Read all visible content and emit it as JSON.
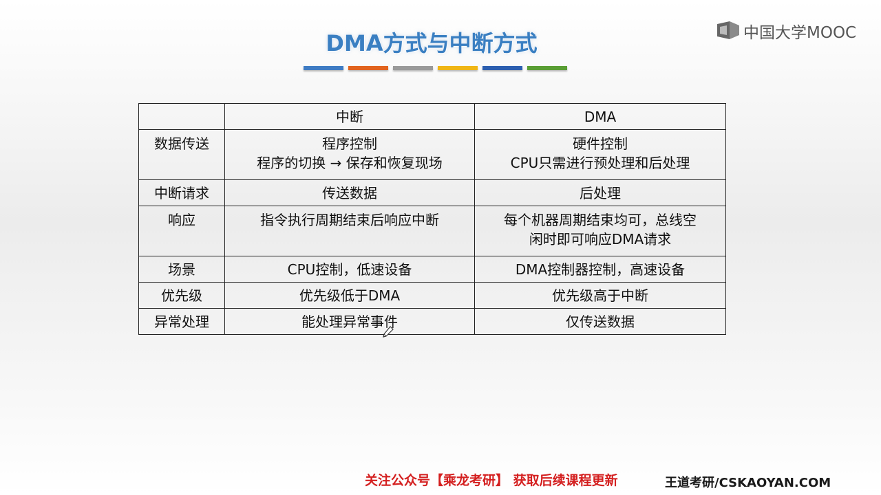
{
  "logo": {
    "text": "中国大学MOOC",
    "icon": "mooc-logo-icon"
  },
  "slide": {
    "title": "DMA方式与中断方式",
    "accent_colors": [
      "#3f7cc4",
      "#e2641f",
      "#9a9a9a",
      "#f0b616",
      "#2d5fb0",
      "#5a9e35"
    ]
  },
  "table": {
    "headers": [
      "",
      "中断",
      "DMA"
    ],
    "rows": [
      {
        "label": "数据传送",
        "interrupt": [
          "程序控制",
          "程序的切换 → 保存和恢复现场"
        ],
        "dma": [
          "硬件控制",
          "CPU只需进行预处理和后处理"
        ]
      },
      {
        "label": "中断请求",
        "interrupt": [
          "传送数据"
        ],
        "dma": [
          "后处理"
        ]
      },
      {
        "label": "响应",
        "interrupt": [
          "指令执行周期结束后响应中断"
        ],
        "dma": [
          "每个机器周期结束均可，总线空",
          "闲时即可响应DMA请求"
        ]
      },
      {
        "label": "场景",
        "interrupt": [
          "CPU控制，低速设备"
        ],
        "dma": [
          "DMA控制器控制，高速设备"
        ]
      },
      {
        "label": "优先级",
        "interrupt": [
          "优先级低于DMA"
        ],
        "dma": [
          "优先级高于中断"
        ]
      },
      {
        "label": "异常处理",
        "interrupt": [
          "能处理异常事件"
        ],
        "dma": [
          "仅传送数据"
        ]
      }
    ]
  },
  "footer": {
    "promo": "关注公众号【乘龙考研】 获取后续课程更新",
    "site": "王道考研/CSKAOYAN.COM"
  }
}
